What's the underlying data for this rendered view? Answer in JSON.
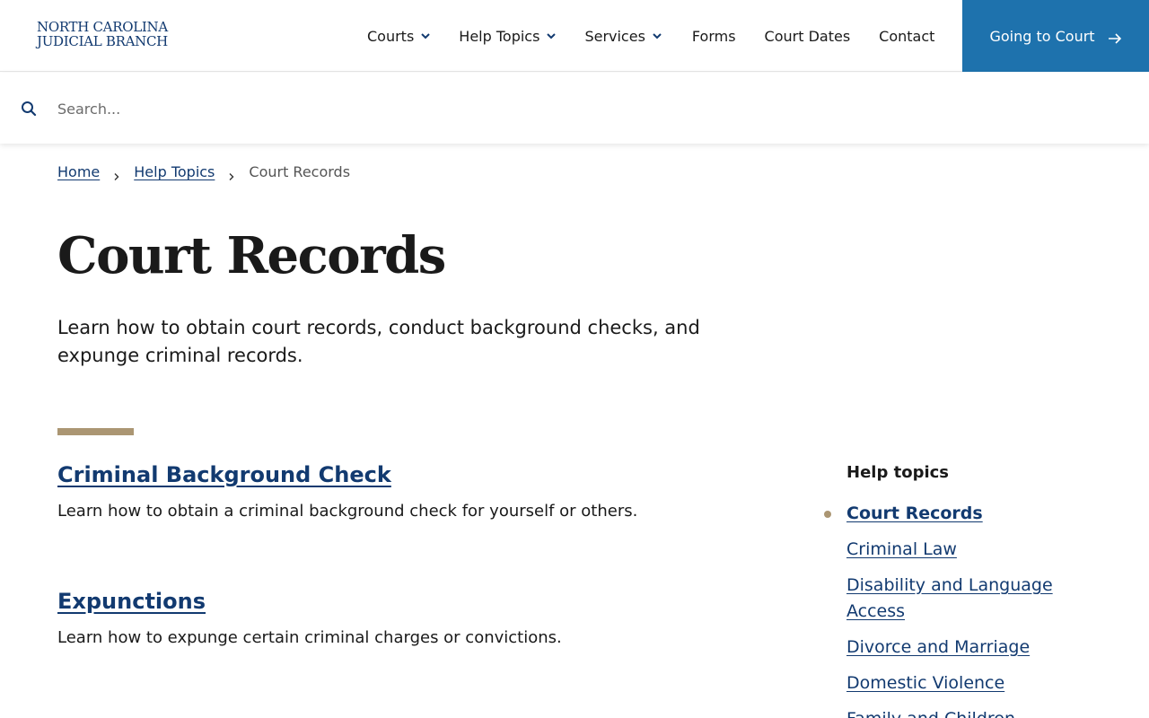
{
  "header": {
    "logo_line1": "NORTH CAROLINA",
    "logo_line2": "JUDICIAL BRANCH",
    "nav": [
      {
        "label": "Courts",
        "has_dropdown": true
      },
      {
        "label": "Help Topics",
        "has_dropdown": true
      },
      {
        "label": "Services",
        "has_dropdown": true
      },
      {
        "label": "Forms",
        "has_dropdown": false
      },
      {
        "label": "Court Dates",
        "has_dropdown": false
      },
      {
        "label": "Contact",
        "has_dropdown": false
      }
    ],
    "cta_label": "Going to Court"
  },
  "search": {
    "placeholder": "Search...",
    "value": ""
  },
  "breadcrumb": {
    "items": [
      "Home",
      "Help Topics"
    ],
    "current": "Court Records"
  },
  "page": {
    "title": "Court Records",
    "lede": "Learn how to obtain court records, conduct background checks, and expunge criminal records."
  },
  "cards": [
    {
      "title": "Criminal Background Check",
      "description": "Learn how to obtain a criminal background check for yourself or others."
    },
    {
      "title": "Expunctions",
      "description": "Learn how to expunge certain criminal charges or convictions."
    }
  ],
  "sidebar": {
    "heading": "Help topics",
    "items": [
      {
        "label": "Court Records",
        "active": true
      },
      {
        "label": "Criminal Law",
        "active": false
      },
      {
        "label": "Disability and Language Access",
        "active": false
      },
      {
        "label": "Divorce and Marriage",
        "active": false
      },
      {
        "label": "Domestic Violence",
        "active": false
      },
      {
        "label": "Family and Children",
        "active": false
      }
    ]
  },
  "colors": {
    "brand_navy": "#123a70",
    "cta_blue": "#1e72ad",
    "accent_gold": "#ab9673"
  }
}
